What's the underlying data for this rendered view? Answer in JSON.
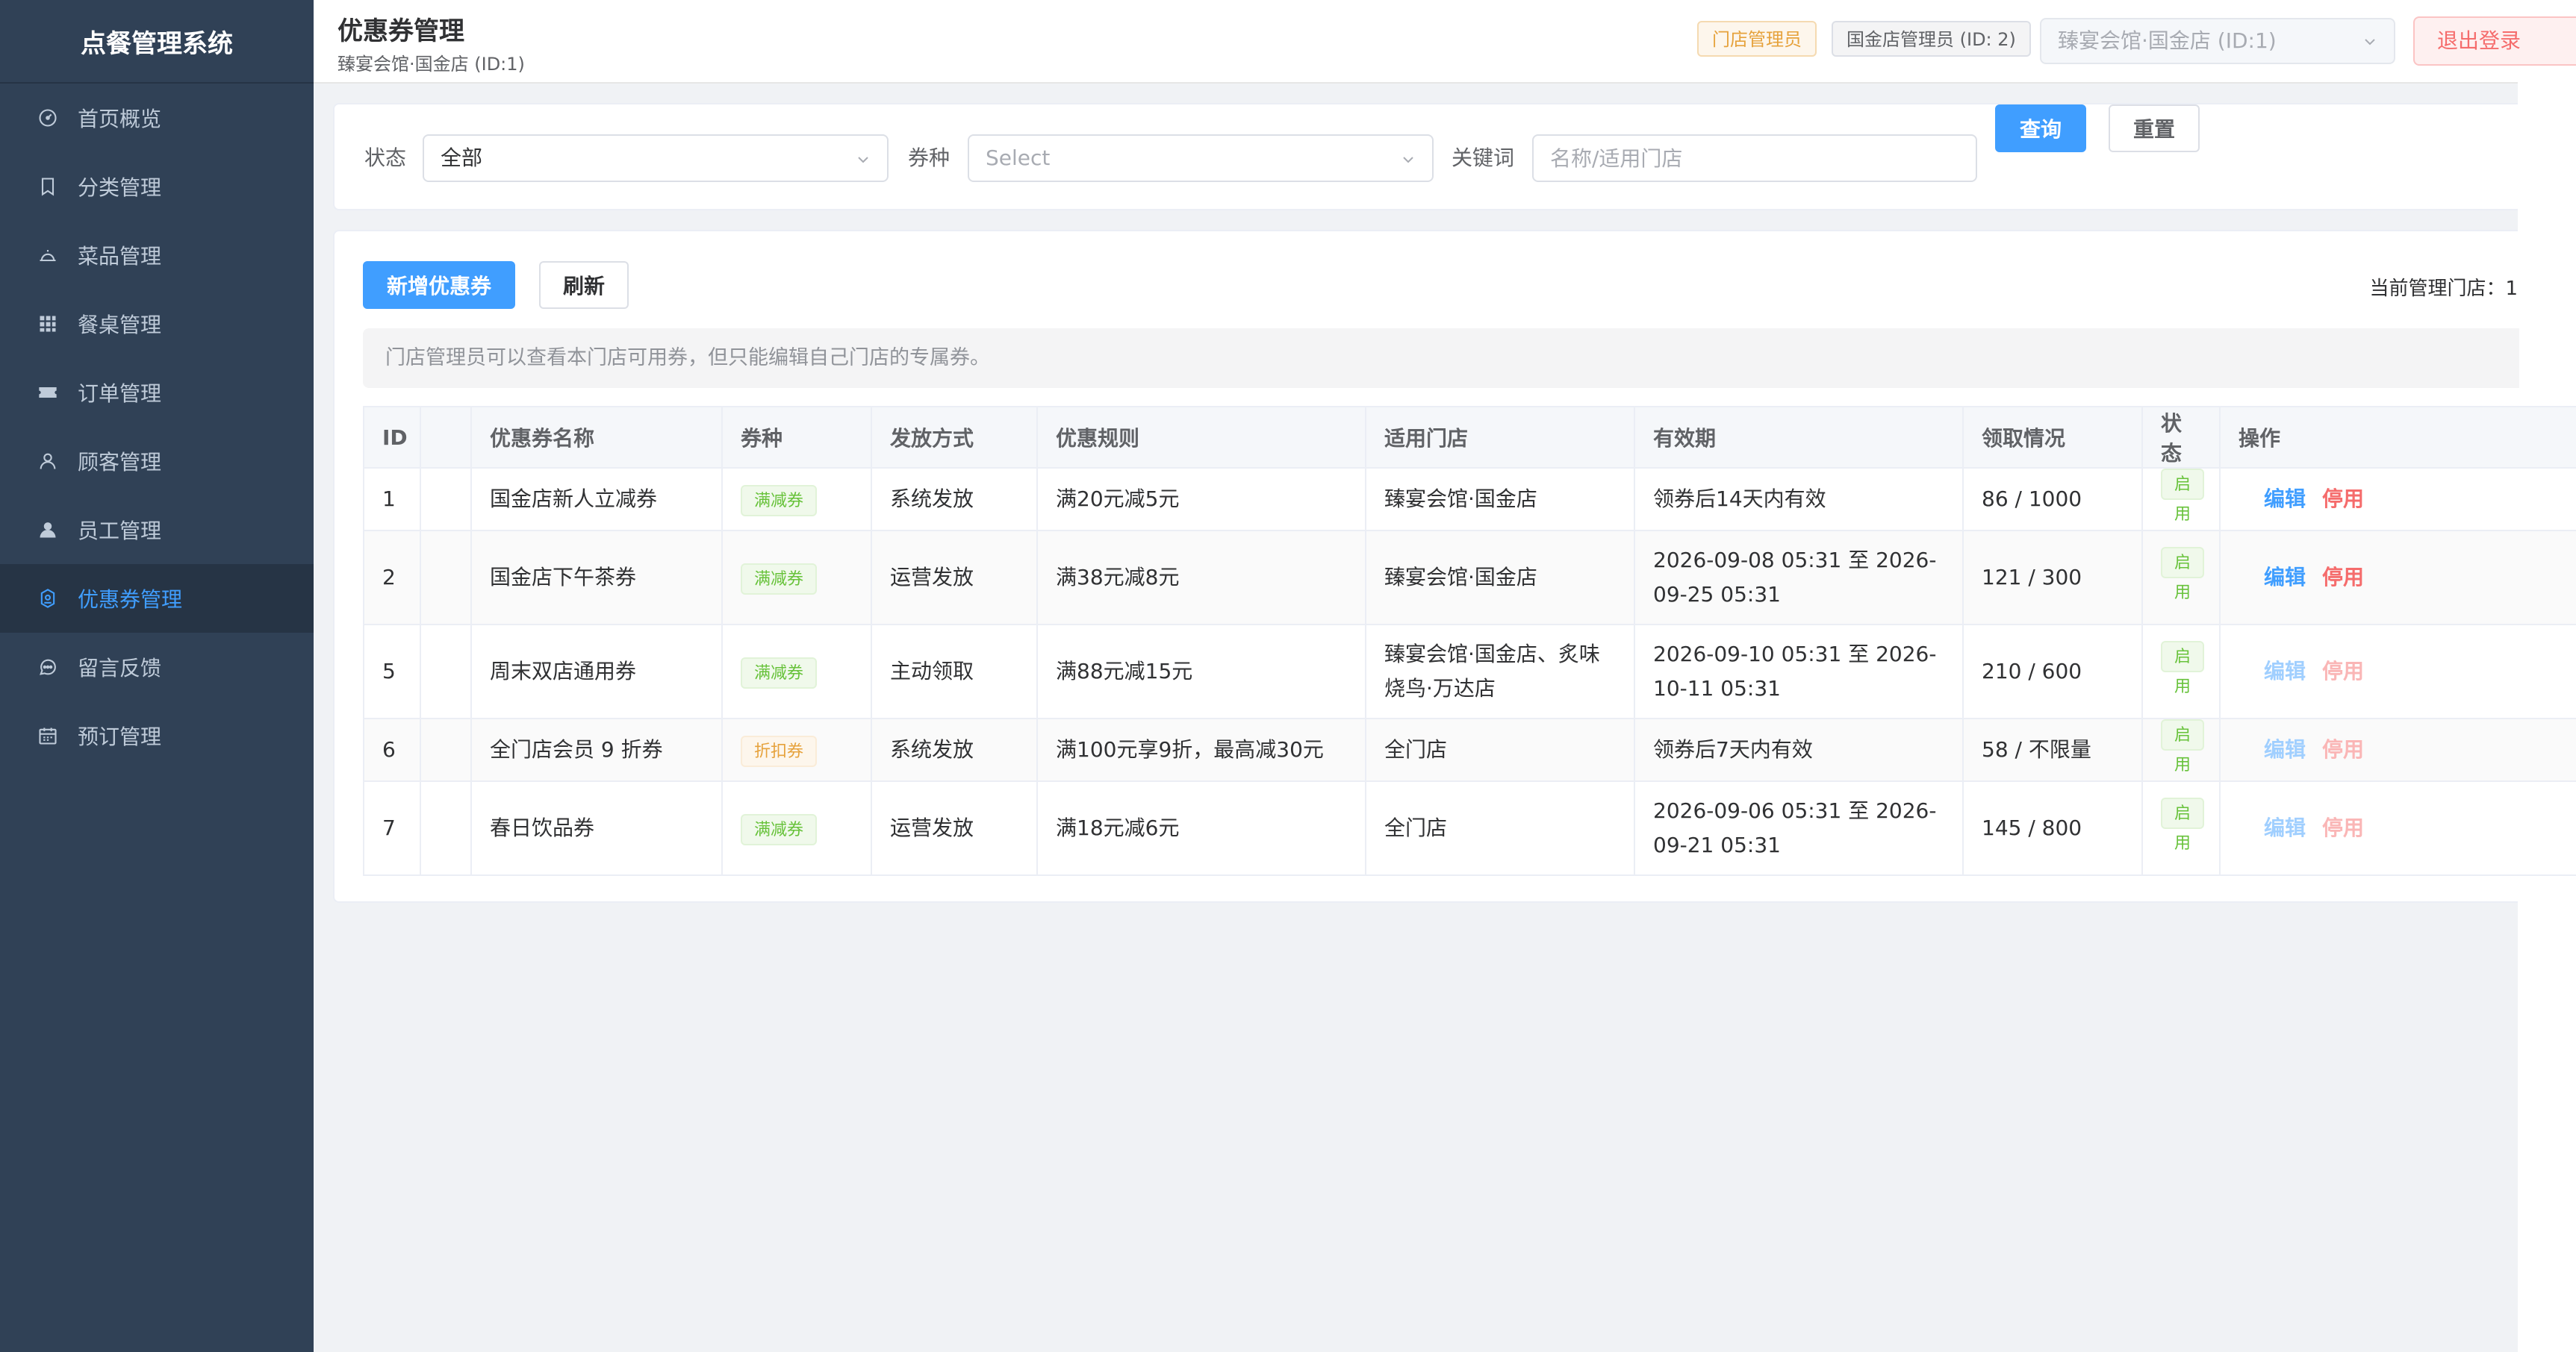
{
  "sidebar": {
    "brand": "点餐管理系统",
    "items": [
      {
        "label": "首页概览",
        "icon": "dashboard-icon",
        "active": false
      },
      {
        "label": "分类管理",
        "icon": "bookmark-icon",
        "active": false
      },
      {
        "label": "菜品管理",
        "icon": "dish-cover-icon",
        "active": false
      },
      {
        "label": "餐桌管理",
        "icon": "grid-icon",
        "active": false
      },
      {
        "label": "订单管理",
        "icon": "ticket-icon",
        "active": false
      },
      {
        "label": "顾客管理",
        "icon": "user-outline-icon",
        "active": false
      },
      {
        "label": "员工管理",
        "icon": "user-filled-icon",
        "active": false
      },
      {
        "label": "优惠券管理",
        "icon": "coupon-icon",
        "active": true
      },
      {
        "label": "留言反馈",
        "icon": "chat-icon",
        "active": false
      },
      {
        "label": "预订管理",
        "icon": "calendar-icon",
        "active": false
      }
    ]
  },
  "header": {
    "title": "优惠券管理",
    "subtitle": "臻宴会馆·国金店 (ID:1)",
    "role_tag": "门店管理员",
    "user_tag": "国金店管理员 (ID: 2)",
    "store_select": "臻宴会馆·国金店 (ID:1)",
    "logout": "退出登录"
  },
  "filter": {
    "status_label": "状态",
    "status_value": "全部",
    "type_label": "券种",
    "type_placeholder": "Select",
    "keyword_label": "关键词",
    "keyword_placeholder": "名称/适用门店",
    "keyword_value": "",
    "search_button": "查询",
    "reset_button": "重置"
  },
  "toolbar": {
    "add_button": "新增优惠券",
    "refresh_button": "刷新",
    "manage_info": "当前管理门店：1"
  },
  "notice": "门店管理员可以查看本门店可用券，但只能编辑自己门店的专属券。",
  "table": {
    "columns": [
      "ID",
      "",
      "优惠券名称",
      "券种",
      "发放方式",
      "优惠规则",
      "适用门店",
      "有效期",
      "领取情况",
      "状态",
      "操作"
    ],
    "rows": [
      {
        "id": "1",
        "name": "国金店新人立减券",
        "type": "满减券",
        "type_color": "#67c23a",
        "issue": "系统发放",
        "rule": "满20元减5元",
        "stores": "臻宴会馆·国金店",
        "validity": "领券后14天内有效",
        "claimed": "86 / 1000",
        "status": "启用",
        "edit": "编辑",
        "disable": "停用",
        "editable": true
      },
      {
        "id": "2",
        "name": "国金店下午茶券",
        "type": "满减券",
        "type_color": "#67c23a",
        "issue": "运营发放",
        "rule": "满38元减8元",
        "stores": "臻宴会馆·国金店",
        "validity": "2026-09-08 05:31 至 2026-09-25 05:31",
        "claimed": "121 / 300",
        "status": "启用",
        "edit": "编辑",
        "disable": "停用",
        "editable": true
      },
      {
        "id": "5",
        "name": "周末双店通用券",
        "type": "满减券",
        "type_color": "#67c23a",
        "issue": "主动领取",
        "rule": "满88元减15元",
        "stores": "臻宴会馆·国金店、炙味烧鸟·万达店",
        "validity": "2026-09-10 05:31 至 2026-10-11 05:31",
        "claimed": "210 / 600",
        "status": "启用",
        "edit": "编辑",
        "disable": "停用",
        "editable": false
      },
      {
        "id": "6",
        "name": "全门店会员 9 折券",
        "type": "折扣券",
        "type_color": "#e6a23c",
        "issue": "系统发放",
        "rule": "满100元享9折，最高减30元",
        "stores": "全门店",
        "validity": "领券后7天内有效",
        "claimed": "58 / 不限量",
        "status": "启用",
        "edit": "编辑",
        "disable": "停用",
        "editable": false
      },
      {
        "id": "7",
        "name": "春日饮品券",
        "type": "满减券",
        "type_color": "#67c23a",
        "issue": "运营发放",
        "rule": "满18元减6元",
        "stores": "全门店",
        "validity": "2026-09-06 05:31 至 2026-09-21 05:31",
        "claimed": "145 / 800",
        "status": "启用",
        "edit": "编辑",
        "disable": "停用",
        "editable": false
      }
    ]
  },
  "colors": {
    "sidebar_bg": "#304156",
    "accent": "#409eff",
    "danger": "#f56c6c",
    "success": "#67c23a",
    "warning": "#e6a23c"
  }
}
